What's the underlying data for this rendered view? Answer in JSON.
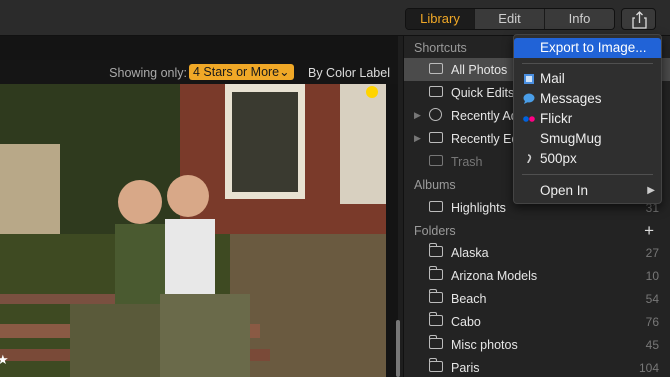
{
  "toolbar": {
    "tabs": [
      {
        "label": "Library",
        "active": true
      },
      {
        "label": "Edit",
        "active": false
      },
      {
        "label": "Info",
        "active": false
      }
    ],
    "share_icon": "share-icon"
  },
  "viewer": {
    "filter_label": "Showing only:",
    "filter_value": "4 Stars or More",
    "sort_label": "By Color Label"
  },
  "sidebar": {
    "shortcuts_header": "Shortcuts",
    "shortcuts": [
      {
        "label": "All Photos",
        "icon": "all-photos-icon",
        "selected": true
      },
      {
        "label": "Quick Edits",
        "icon": "grid-icon"
      },
      {
        "label": "Recently Ad",
        "icon": "plus-circle-icon"
      },
      {
        "label": "Recently Ed",
        "icon": "sliders-icon"
      },
      {
        "label": "Trash",
        "icon": "trash-icon"
      }
    ],
    "albums_header": "Albums",
    "albums": [
      {
        "label": "Highlights",
        "count": "31"
      }
    ],
    "folders_header": "Folders",
    "folders": [
      {
        "label": "Alaska",
        "count": "27"
      },
      {
        "label": "Arizona Models",
        "count": "10"
      },
      {
        "label": "Beach",
        "count": "54"
      },
      {
        "label": "Cabo",
        "count": "76"
      },
      {
        "label": "Misc photos",
        "count": "45"
      },
      {
        "label": "Paris",
        "count": "104"
      }
    ]
  },
  "share_menu": {
    "items": [
      {
        "label": "Export to Image...",
        "icon": "",
        "highlighted": true
      },
      {
        "label": "Mail",
        "icon": "mail-icon"
      },
      {
        "label": "Messages",
        "icon": "messages-icon"
      },
      {
        "label": "Flickr",
        "icon": "flickr-icon"
      },
      {
        "label": "SmugMug",
        "icon": "smugmug-icon"
      },
      {
        "label": "500px",
        "icon": "500px-icon"
      },
      {
        "label": "Open In",
        "icon": "",
        "submenu": true
      }
    ]
  },
  "colors": {
    "accent": "#f0a827",
    "menu_highlight": "#2163d7",
    "sidebar_bg": "#232323"
  }
}
